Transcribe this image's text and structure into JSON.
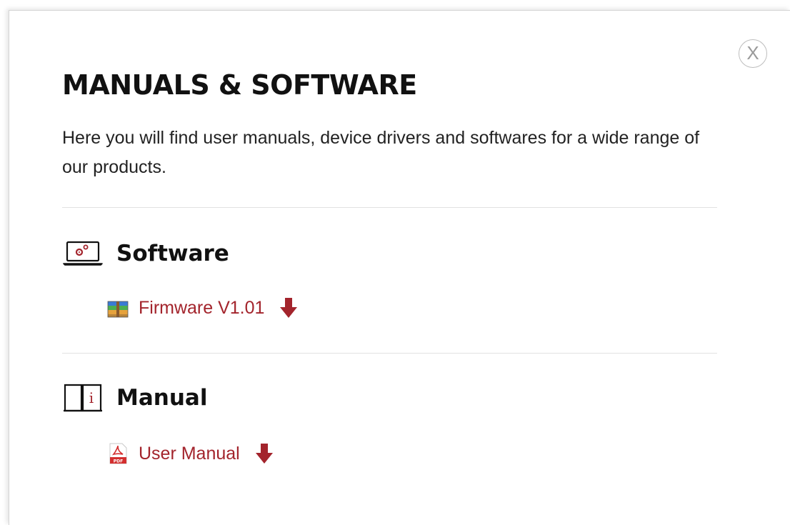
{
  "modal": {
    "close_label": "X",
    "title": "MANUALS & SOFTWARE",
    "intro": "Here you will find user manuals, device drivers and softwares for a wide range of our products."
  },
  "sections": [
    {
      "title": "Software",
      "icon": "laptop-settings-icon",
      "files": [
        {
          "label": "Firmware V1.01",
          "icon": "archive-icon",
          "action_icon": "download-arrow-icon"
        }
      ]
    },
    {
      "title": "Manual",
      "icon": "info-book-icon",
      "files": [
        {
          "label": "User Manual",
          "icon": "pdf-icon",
          "action_icon": "download-arrow-icon"
        }
      ]
    }
  ],
  "colors": {
    "link": "#a3242c",
    "download_arrow": "#a3242c",
    "text": "#222222",
    "divider": "#e2e2e2"
  }
}
